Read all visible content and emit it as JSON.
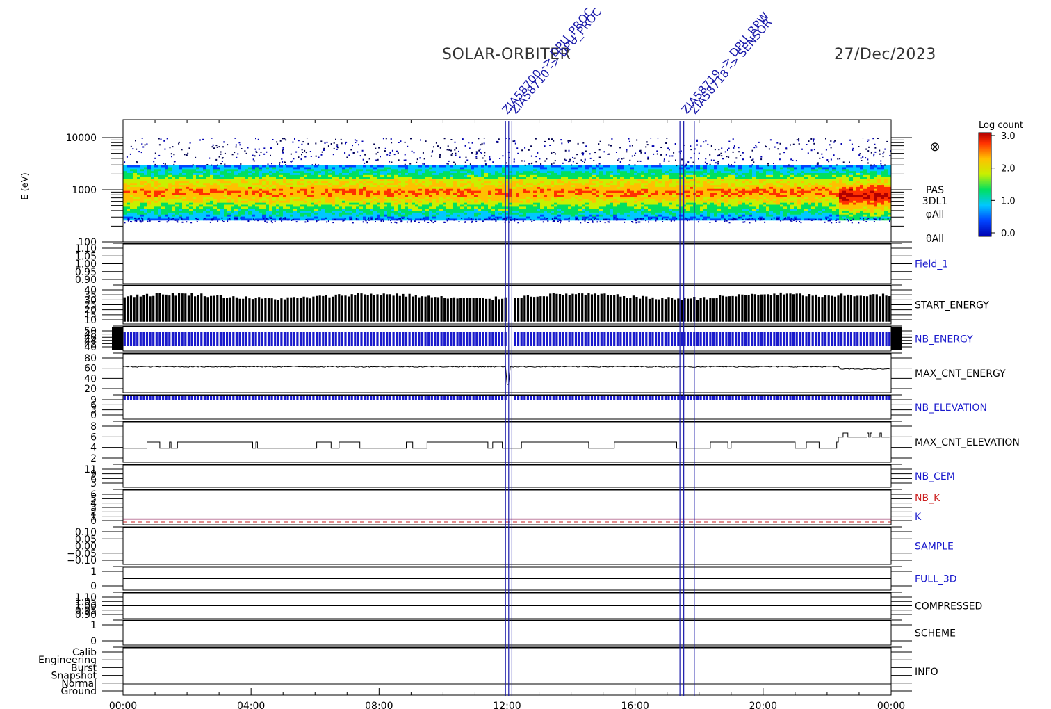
{
  "header": {
    "mission": "SOLAR-ORBITER",
    "date": "27/Dec/2023"
  },
  "colors": {
    "axis": "#000000",
    "blue": "#1a1acc",
    "red": "#cc2222",
    "marker": "#1a1aaa"
  },
  "events": {
    "color": "#1a1aaa",
    "annotation_text": [
      "ZIA58700 -> DPU_PROC",
      "ZIA58710 -> DPU_PROC",
      "ZIA58719 -> DPU_RPW",
      "ZIA58718 -> SENSOR"
    ],
    "times_h": [
      11.95,
      12.05,
      12.15,
      17.4,
      17.52,
      17.85
    ]
  },
  "spectrogram": {
    "ylabel": "E (eV)",
    "yticks": [
      "10000",
      "1000",
      "100"
    ],
    "right_labels": [
      "PAS",
      "3DL1",
      "φAll",
      "θAll"
    ],
    "symbol": "⊗",
    "colorbar": {
      "title": "Log count",
      "ticks": [
        "3.0",
        "2.0",
        "1.0",
        "0.0"
      ]
    }
  },
  "chart_data": {
    "type": "spectrogram",
    "x_range_hours": [
      0,
      24
    ],
    "xticks": [
      "00:00",
      "04:00",
      "08:00",
      "12:00",
      "16:00",
      "20:00",
      "00:00"
    ],
    "energy_range_ev": [
      100,
      10000
    ],
    "colorbar_range": [
      0.0,
      3.0
    ],
    "panels": [
      {
        "key": "field1",
        "name": "Field_1",
        "name_color": "blue",
        "kind": "empty",
        "yticks": [
          "1.10",
          "1.05",
          "1.00",
          "0.95",
          "0.90"
        ],
        "ylim": [
          0.9,
          1.1
        ]
      },
      {
        "key": "start",
        "name": "START_ENERGY",
        "name_color": "black",
        "kind": "bars",
        "yticks": [
          "40",
          "35",
          "30",
          "25",
          "20",
          "15",
          "10"
        ],
        "ylim": [
          8,
          42
        ],
        "baseline": 29,
        "late_level": 32,
        "gap_h": [
          11.95,
          12.15
        ]
      },
      {
        "key": "nbe",
        "name": "NB_ENERGY",
        "name_color": "blue",
        "kind": "bluebars",
        "yticks": [
          "50",
          "48",
          "46",
          "44",
          "42",
          "40"
        ],
        "ylim": [
          40,
          50
        ],
        "band": [
          42,
          48
        ]
      },
      {
        "key": "maxce",
        "name": "MAX_CNT_ENERGY",
        "name_color": "black",
        "kind": "line",
        "yticks": [
          "80",
          "60",
          "40",
          "20"
        ],
        "ylim": [
          10,
          80
        ],
        "level": 57,
        "late_level": 52,
        "step_h": 22.4
      },
      {
        "key": "nbel",
        "name": "NB_ELEVATION",
        "name_color": "blue",
        "kind": "bluebars",
        "yticks": [
          "9",
          "6",
          "3",
          "0"
        ],
        "ylim": [
          0,
          10
        ],
        "band": [
          8,
          10
        ]
      },
      {
        "key": "maxcel",
        "name": "MAX_CNT_ELEVATION",
        "name_color": "black",
        "kind": "steps",
        "yticks": [
          "8",
          "6",
          "4",
          "2"
        ],
        "ylim": [
          1,
          9
        ],
        "level_a": 3.8,
        "level_b": 5,
        "late_level": 6
      },
      {
        "key": "nbcem",
        "name": "NB_CEM",
        "name_color": "blue",
        "kind": "empty",
        "yticks": [
          "11",
          "9",
          "6",
          "3"
        ],
        "ylim": [
          0,
          12
        ]
      },
      {
        "key": "nbk",
        "name": "NB_K",
        "name_color": "red",
        "name2": "K",
        "name2_color": "blue",
        "kind": "k",
        "yticks": [
          "6",
          "5",
          "4",
          "3",
          "2",
          "1",
          "0"
        ],
        "ylim": [
          0,
          6
        ],
        "k_value": 1
      },
      {
        "key": "sample",
        "name": "SAMPLE",
        "name_color": "blue",
        "kind": "empty",
        "yticks": [
          "0.10",
          "0.05",
          "0.00",
          "−0.05",
          "−0.10"
        ],
        "ylim": [
          -0.1,
          0.1
        ]
      },
      {
        "key": "full3d",
        "name": "FULL_3D",
        "name_color": "blue",
        "kind": "empty",
        "yticks": [
          "1",
          "0"
        ],
        "ylim": [
          -0.5,
          1.5
        ]
      },
      {
        "key": "compressed",
        "name": "COMPRESSED",
        "name_color": "black",
        "kind": "empty",
        "yticks": [
          "1.10",
          "1.05",
          "1.00",
          "0.95",
          "0.90"
        ],
        "ylim": [
          0.9,
          1.1
        ]
      },
      {
        "key": "scheme",
        "name": "SCHEME",
        "name_color": "black",
        "kind": "empty",
        "yticks": [
          "1",
          "0"
        ],
        "ylim": [
          -0.5,
          1.5
        ]
      },
      {
        "key": "info",
        "name": "INFO",
        "name_color": "black",
        "kind": "info",
        "yticks": [
          "Calib",
          "Engineering",
          "Burst",
          "Snapshot",
          "Normal",
          "Ground"
        ]
      }
    ]
  }
}
